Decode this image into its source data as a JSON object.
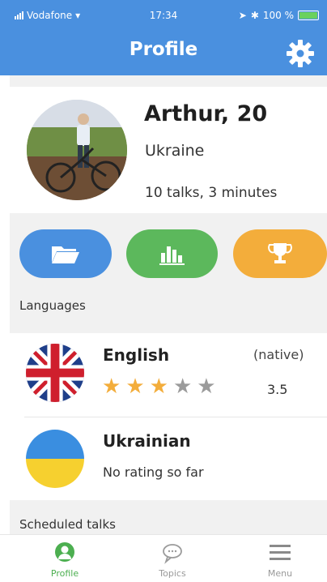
{
  "status_bar": {
    "carrier": "Vodafone",
    "time": "17:34",
    "battery": "100 %"
  },
  "header": {
    "title": "Profile",
    "settings_icon": "gear-icon",
    "accent_color": "#4a90df"
  },
  "profile": {
    "name": "Arthur, 20",
    "country": "Ukraine",
    "stats": "10 talks, 3 minutes"
  },
  "actions": [
    {
      "icon": "folder-icon",
      "color": "#4a90df"
    },
    {
      "icon": "bar-chart-icon",
      "color": "#5cb85c"
    },
    {
      "icon": "trophy-icon",
      "color": "#f3ad3b"
    }
  ],
  "languages": {
    "label": "Languages",
    "items": [
      {
        "name": "English",
        "tag": "(native)",
        "stars_filled": 3,
        "stars_total": 5,
        "rating": "3.5",
        "flag": "uk-flag-icon"
      },
      {
        "name": "Ukrainian",
        "rating_text": "No rating so far",
        "flag": "ukraine-flag-icon"
      }
    ]
  },
  "scheduled": {
    "label": "Scheduled talks"
  },
  "tabbar": {
    "tabs": [
      {
        "label": "Profile",
        "icon": "person-icon",
        "active": true
      },
      {
        "label": "Topics",
        "icon": "chat-bubbles-icon",
        "active": false
      },
      {
        "label": "Menu",
        "icon": "hamburger-icon",
        "active": false
      }
    ],
    "active_color": "#4caf50"
  }
}
